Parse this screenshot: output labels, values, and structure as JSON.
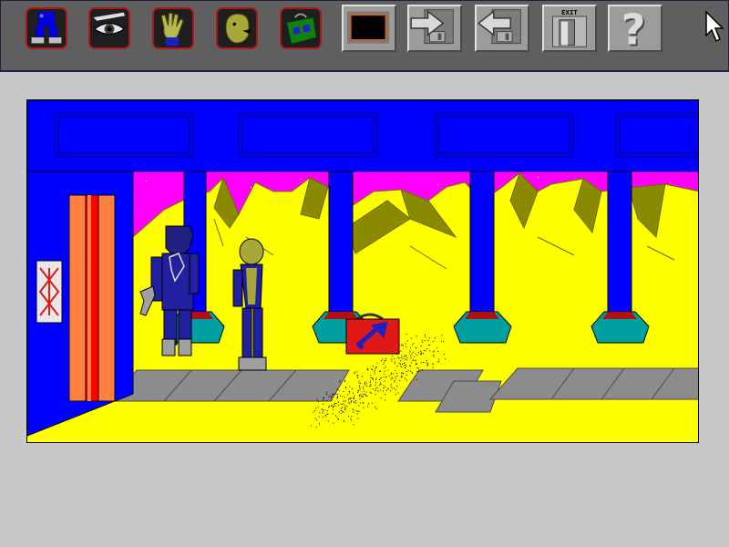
{
  "toolbar": {
    "verbs": [
      {
        "icon": "walk-feet-icon",
        "action": "walk"
      },
      {
        "icon": "eye-icon",
        "action": "look"
      },
      {
        "icon": "hand-icon",
        "action": "take"
      },
      {
        "icon": "talk-head-icon",
        "action": "talk"
      },
      {
        "icon": "inventory-bag-icon",
        "action": "inventory"
      }
    ],
    "buttons": [
      {
        "icon": "current-item-slot-icon"
      },
      {
        "icon": "save-game-icon"
      },
      {
        "icon": "load-game-icon"
      },
      {
        "icon": "exit-door-icon",
        "label": "EXIT"
      },
      {
        "icon": "help-question-icon",
        "label": "?"
      }
    ]
  },
  "scene": {
    "location": "lunar-station-platform",
    "colors": {
      "sky": "#ff00ff",
      "ground": "#ffff00",
      "structure": "#0000ff",
      "mountains": "#8a8a00",
      "door": "#ff8040",
      "toolbox": "#e01818"
    },
    "objects": [
      "elevator-door",
      "warning-sign",
      "armed-guard",
      "player-character",
      "red-toolbox",
      "blue-pillar",
      "blue-pillar",
      "blue-pillar",
      "blue-pillar",
      "floor-panels"
    ]
  }
}
